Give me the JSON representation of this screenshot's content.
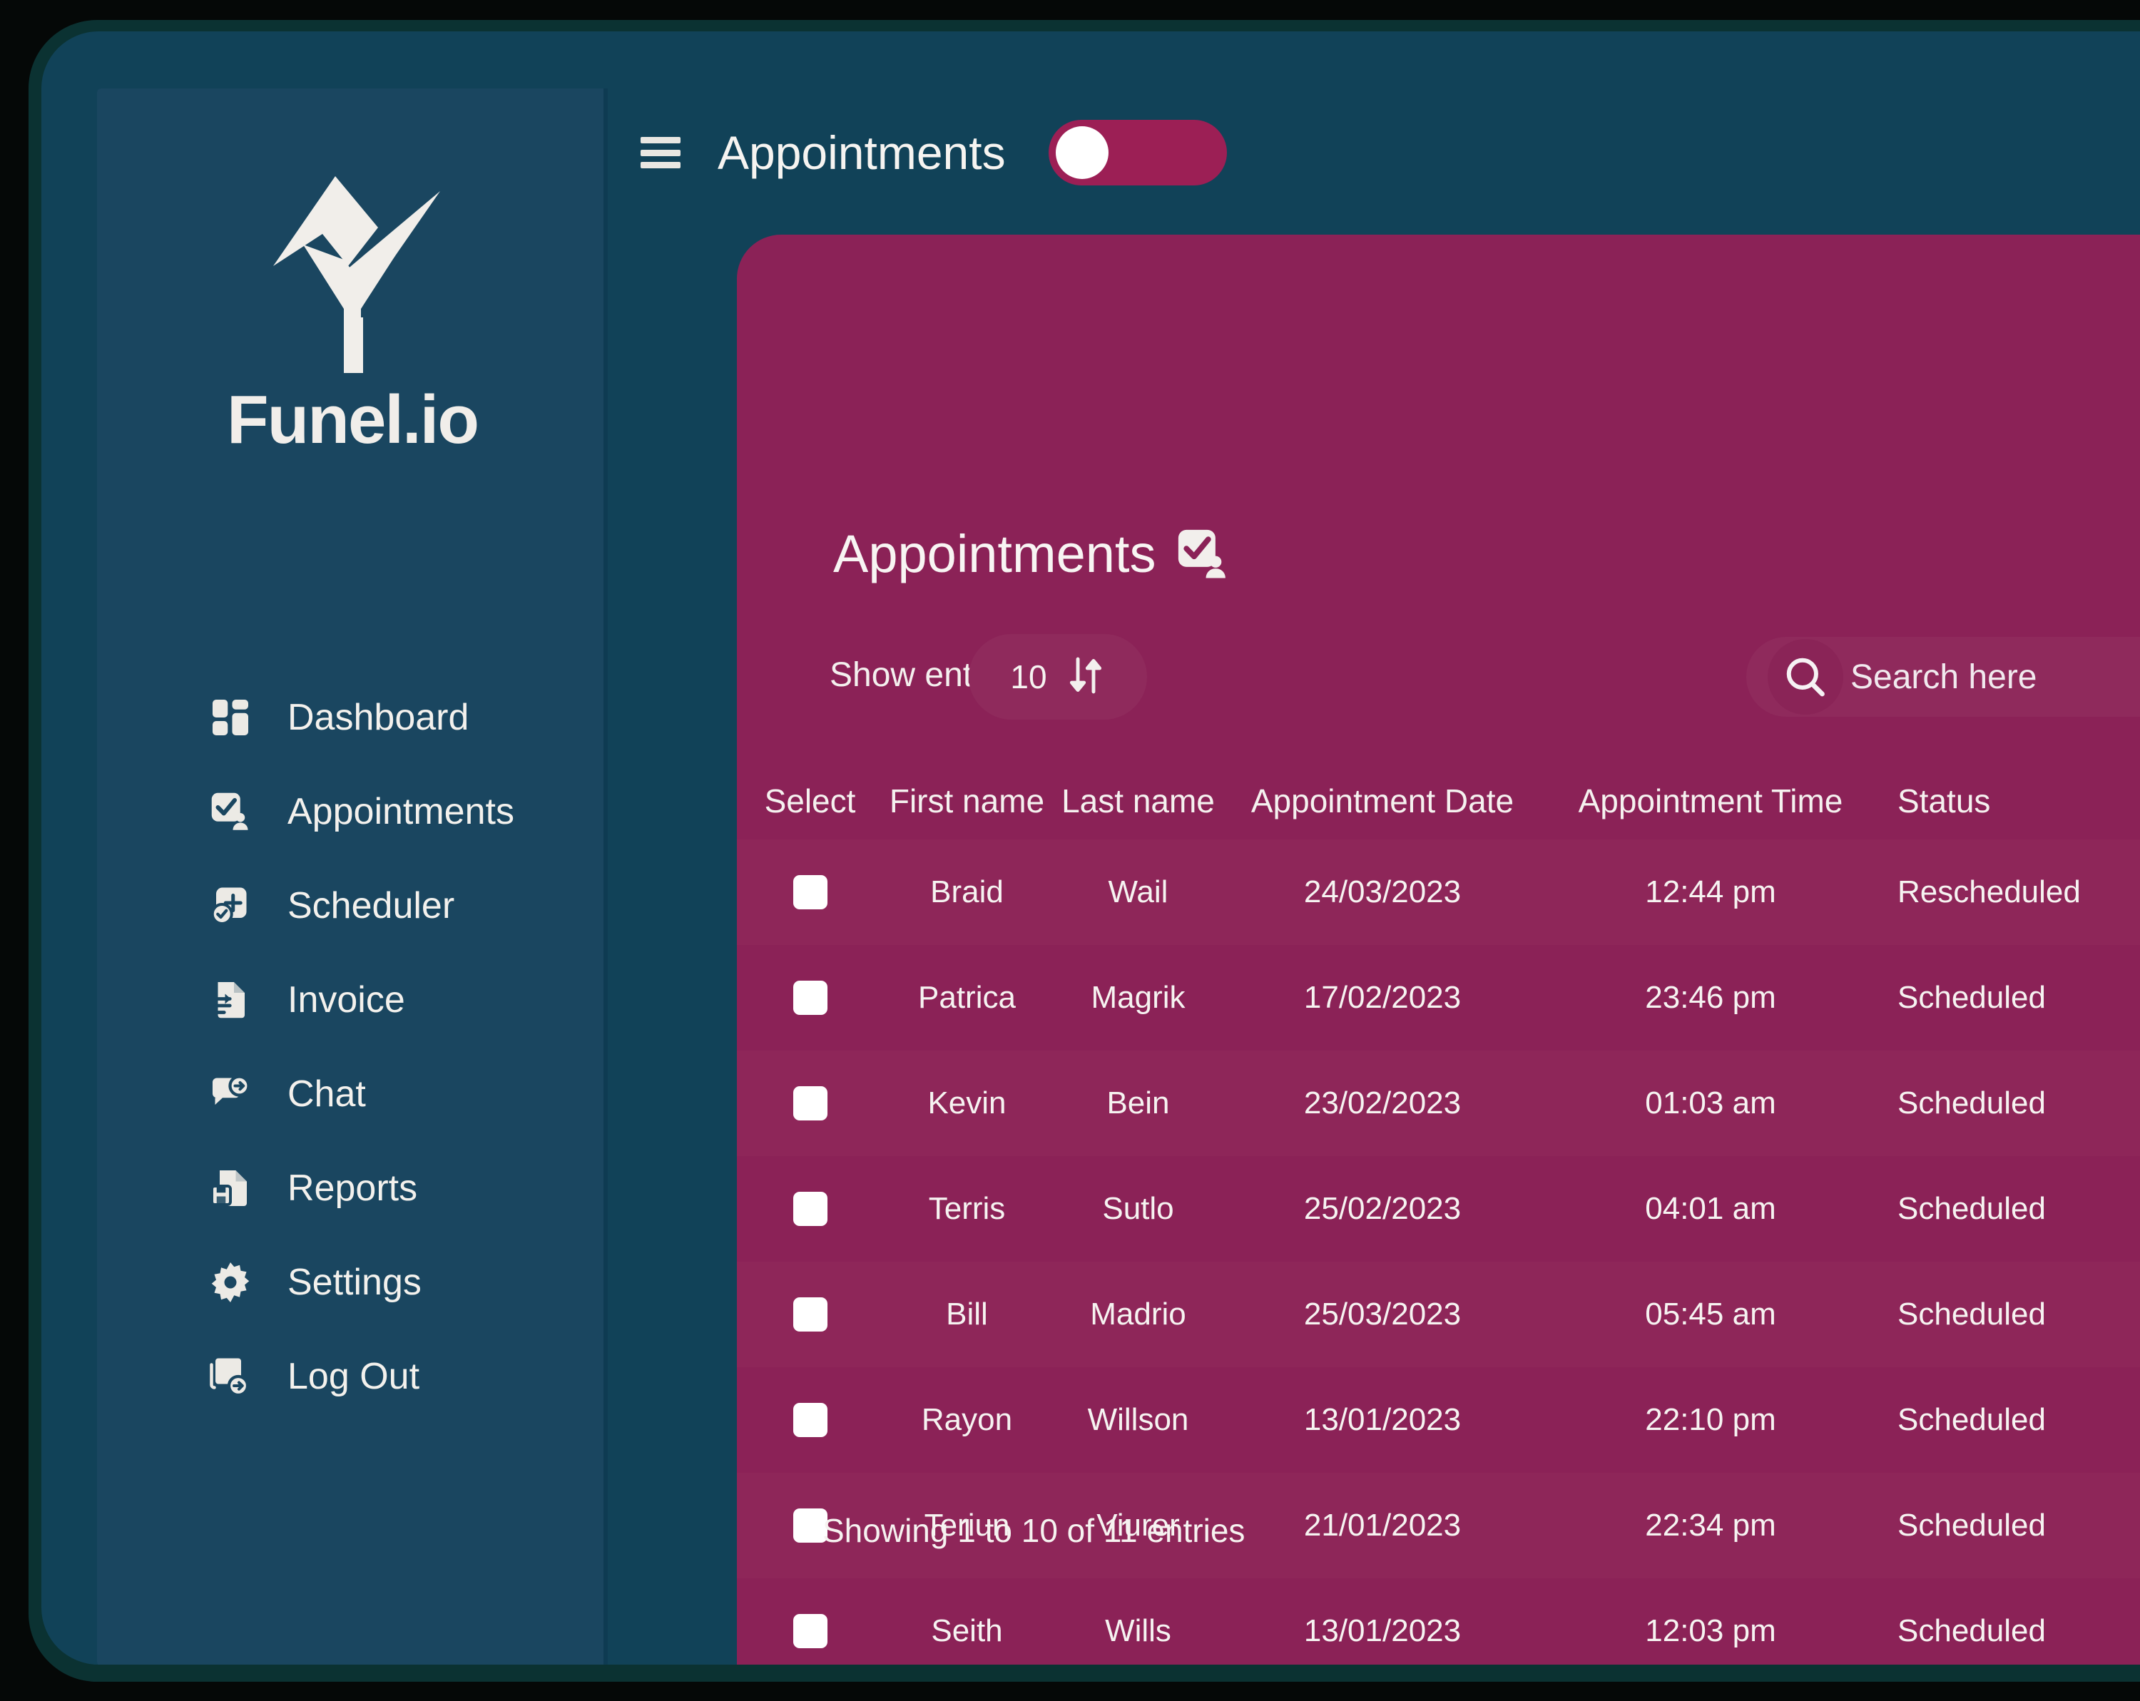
{
  "theme": {
    "page_background": "#050807",
    "shell_shadow": "#0d3a3a",
    "window_frame": "#114258",
    "sidebar_bg": "#1a4660",
    "card_bg": "#8b2257",
    "card_row_alt": "#8e2659",
    "accent_magenta": "#9c1f55",
    "text_light": "#f6f3f1"
  },
  "brand": {
    "name": "Funel.io",
    "logo_icon": "funnel-checkmark-logo"
  },
  "sidebar": {
    "items": [
      {
        "label": "Dashboard",
        "icon": "grid-dashboard-icon",
        "active": false
      },
      {
        "label": "Appointments",
        "icon": "checkbox-person-icon",
        "active": true
      },
      {
        "label": "Scheduler",
        "icon": "calendar-clock-plus-icon",
        "active": false
      },
      {
        "label": "Invoice",
        "icon": "invoice-document-icon",
        "active": false
      },
      {
        "label": "Chat",
        "icon": "chat-bubble-arrow-icon",
        "active": false
      },
      {
        "label": "Reports",
        "icon": "report-save-icon",
        "active": false
      },
      {
        "label": "Settings",
        "icon": "gear-icon",
        "active": false
      },
      {
        "label": "Log Out",
        "icon": "logout-arrow-icon",
        "active": false
      }
    ]
  },
  "topbar": {
    "menu_icon": "hamburger-menu-icon",
    "title": "Appointments",
    "theme_toggle": {
      "state": "off",
      "icon": "toggle-switch"
    }
  },
  "card": {
    "title": "Appointments",
    "title_icon": "checkbox-person-icon",
    "show_entries_label": "Show entries:",
    "entries_value": "10",
    "entries_sort_icon": "sort-updown-icon",
    "search": {
      "icon": "search-icon",
      "placeholder": "Search here",
      "value": ""
    },
    "footer": "Showing 1 to 10 of 11 entries"
  },
  "table": {
    "columns": [
      "Select",
      "First name",
      "Last name",
      "Appointment Date",
      "Appointment Time",
      "Status"
    ],
    "rows": [
      {
        "select": "",
        "first": "Braid",
        "last": "Wail",
        "date": "24/03/2023",
        "time": "12:44 pm",
        "status": "Rescheduled"
      },
      {
        "select": "",
        "first": "Patrica",
        "last": "Magrik",
        "date": "17/02/2023",
        "time": "23:46 pm",
        "status": "Scheduled"
      },
      {
        "select": "",
        "first": "Kevin",
        "last": "Bein",
        "date": "23/02/2023",
        "time": "01:03 am",
        "status": "Scheduled"
      },
      {
        "select": "",
        "first": "Terris",
        "last": "Sutlo",
        "date": "25/02/2023",
        "time": "04:01 am",
        "status": "Scheduled"
      },
      {
        "select": "",
        "first": "Bill",
        "last": "Madrio",
        "date": "25/03/2023",
        "time": "05:45 am",
        "status": "Scheduled"
      },
      {
        "select": "",
        "first": "Rayon",
        "last": "Willson",
        "date": "13/01/2023",
        "time": "22:10 pm",
        "status": "Scheduled"
      },
      {
        "select": "",
        "first": "Teriun",
        "last": "Viurer",
        "date": "21/01/2023",
        "time": "22:34 pm",
        "status": "Scheduled"
      },
      {
        "select": "",
        "first": "Seith",
        "last": "Wills",
        "date": "13/01/2023",
        "time": "12:03 pm",
        "status": "Scheduled"
      }
    ]
  }
}
